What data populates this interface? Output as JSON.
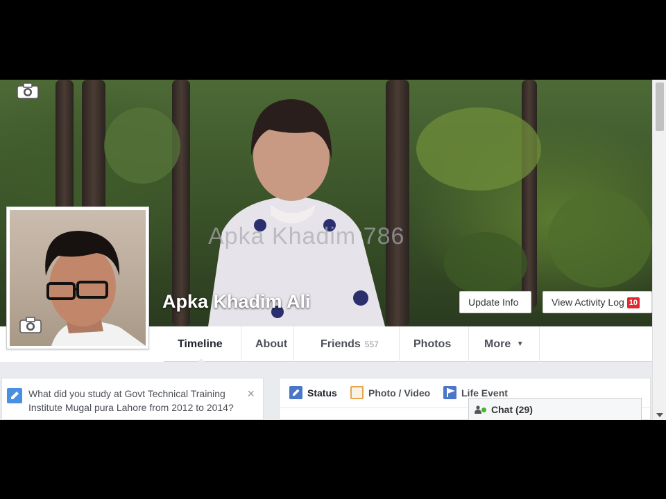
{
  "cover": {
    "watermark": "Apka Khadim 786",
    "profile_name": "Apka Khadim Ali",
    "update_info_label": "Update Info",
    "view_activity_log_label": "View Activity Log",
    "activity_badge": "10"
  },
  "nav": {
    "tabs": [
      {
        "label": "Timeline"
      },
      {
        "label": "About"
      },
      {
        "label": "Friends",
        "count": "557"
      },
      {
        "label": "Photos"
      },
      {
        "label": "More",
        "icon": "caret-down"
      }
    ]
  },
  "prompt_card": {
    "text": "What did you study at Govt Technical Training Institute Mugal pura Lahore from 2012 to 2014?",
    "close": "×"
  },
  "composer": {
    "status_label": "Status",
    "photo_video_label": "Photo / Video",
    "life_event_label": "Life Event"
  },
  "chat": {
    "label": "Chat (29)"
  },
  "colors": {
    "accent": "#4a77c9",
    "badge": "#e3262f",
    "online": "#42b72a"
  }
}
